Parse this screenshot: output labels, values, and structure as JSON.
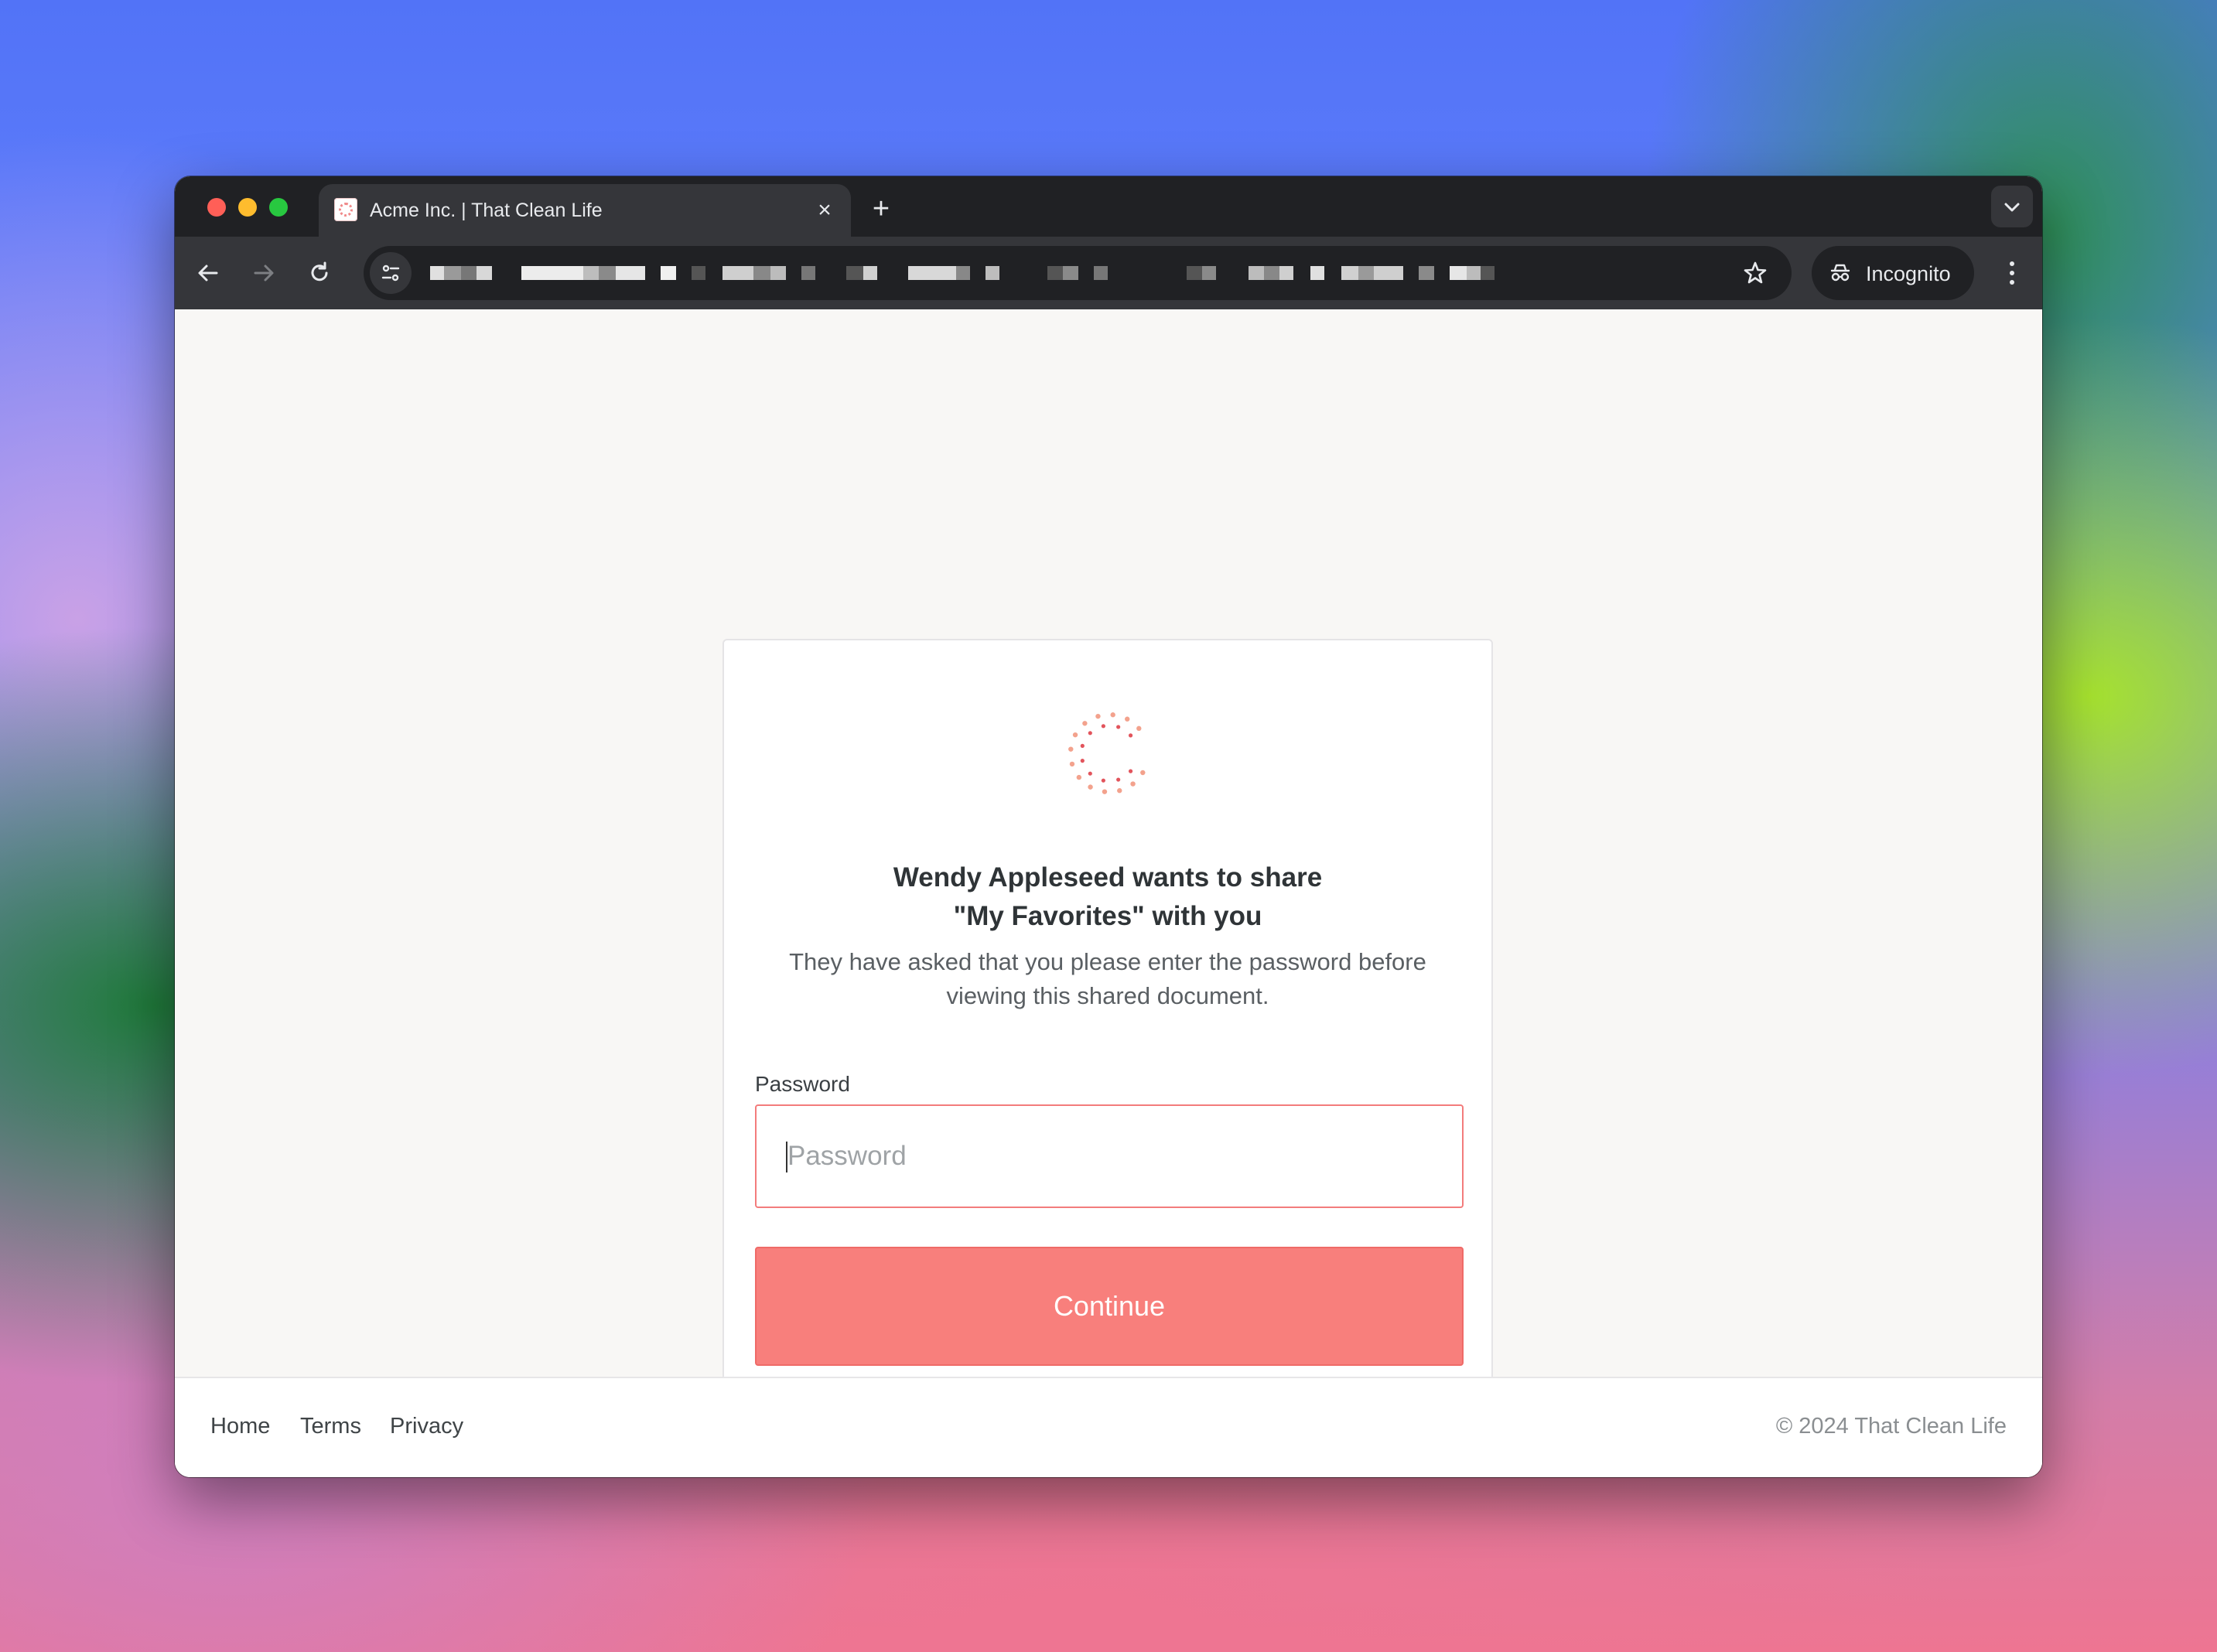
{
  "browser": {
    "tab_title": "Acme Inc. | That Clean Life",
    "tab_close_icon": "close-icon",
    "new_tab_icon": "plus-icon",
    "tab_search_icon": "chevron-down-icon",
    "incognito_label": "Incognito",
    "icons": {
      "back": "arrow-left-icon",
      "forward": "arrow-right-icon",
      "reload": "reload-icon",
      "site_info": "tune-icon",
      "bookmark": "star-icon",
      "incognito": "incognito-icon",
      "menu": "more-vert-icon"
    }
  },
  "share": {
    "title_line1": "Wendy Appleseed wants to share",
    "title_line2": "\"My Favorites\" with you",
    "description": "They have asked that you please enter the password before viewing this shared document.",
    "password_label": "Password",
    "password_placeholder": "Password",
    "password_value": "",
    "continue_label": "Continue"
  },
  "footer": {
    "links": [
      "Home",
      "Terms",
      "Privacy"
    ],
    "copyright": "© 2024 That Clean Life"
  },
  "colors": {
    "accent": "#f87f7c",
    "accent_border": "#f37c7c",
    "chrome_dark": "#202124",
    "chrome_toolbar": "#35363a"
  }
}
